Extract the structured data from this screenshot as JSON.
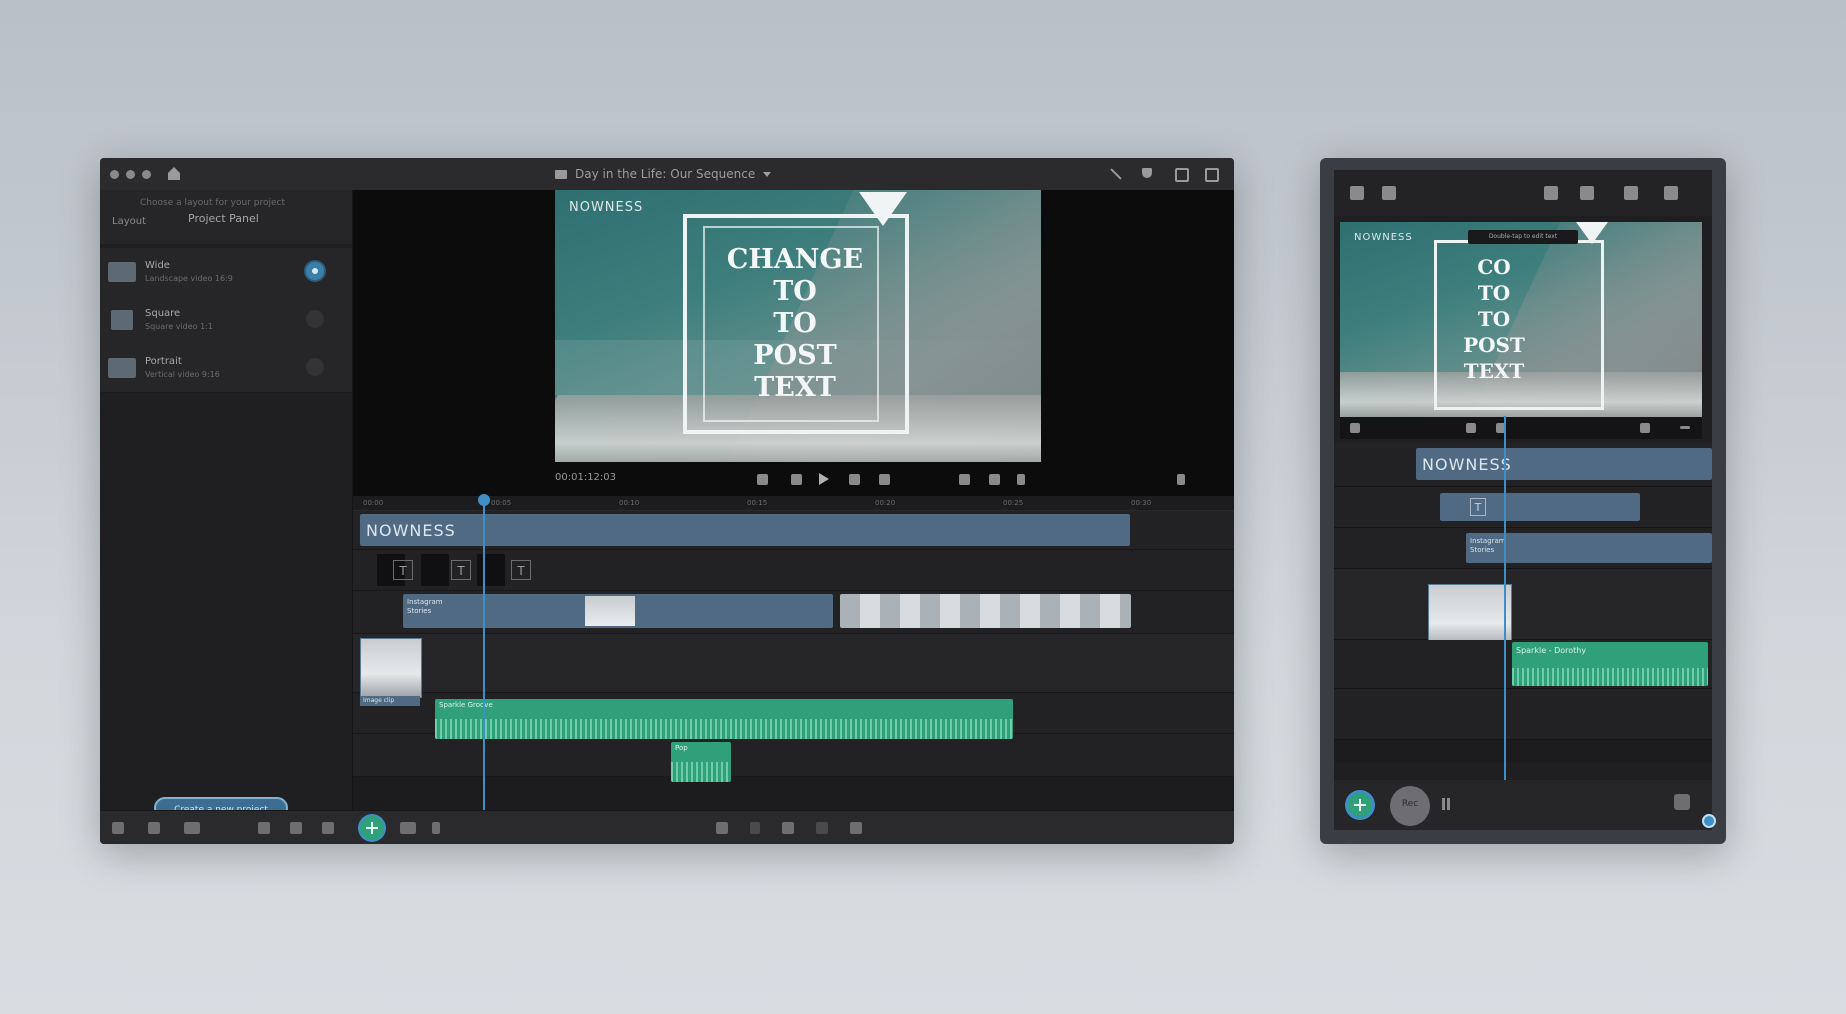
{
  "colors": {
    "background": "#c3c9d0",
    "accent_blue": "#3f8fc7",
    "audio_green": "#2fa07a",
    "clip_blue": "#4f6a82"
  },
  "desktop": {
    "window_title": "Day in the Life: Our Sequence",
    "sidebar": {
      "subtitle": "Choose a layout for your project",
      "tab_left": "Layout",
      "tab_right": "Project Panel",
      "items": [
        {
          "name": "Wide",
          "desc": "Landscape video 16:9",
          "icon": "landscape-thumb-icon",
          "selected": true
        },
        {
          "name": "Square",
          "desc": "Square video 1:1",
          "icon": "square-thumb-icon",
          "selected": false
        },
        {
          "name": "Portrait",
          "desc": "Vertical video 9:16",
          "icon": "portrait-thumb-icon",
          "selected": false
        }
      ],
      "cta": "Create a new project"
    },
    "viewer": {
      "brand": "NOWNESS",
      "overlay_text": "CHANGE\nTO\nTO\nPOST\nTEXT",
      "timecode": "00:01:12:03"
    },
    "timeline": {
      "ticks": [
        "00:00",
        "00:05",
        "00:10",
        "00:15",
        "00:20",
        "00:25",
        "00:30"
      ],
      "title_clip": "NOWNESS",
      "text_markers": [
        "T",
        "T",
        "T"
      ],
      "video_clip_label": "Instagram Stories",
      "image_clip_label": "Image clip",
      "audio_clip_1": "Sparkle Groove",
      "audio_clip_2": "Pop"
    }
  },
  "tablet": {
    "brand": "NOWNESS",
    "tooltip": "Double-tap to edit text",
    "overlay_text": "CO\nTO\nTO\nPOST\nTEXT",
    "title_clip": "NOWNESS",
    "text_marker": "T",
    "video_clip_label": "Instagram Stories",
    "audio_clip": "Sparkle - Dorothy",
    "record_label": "Rec"
  }
}
